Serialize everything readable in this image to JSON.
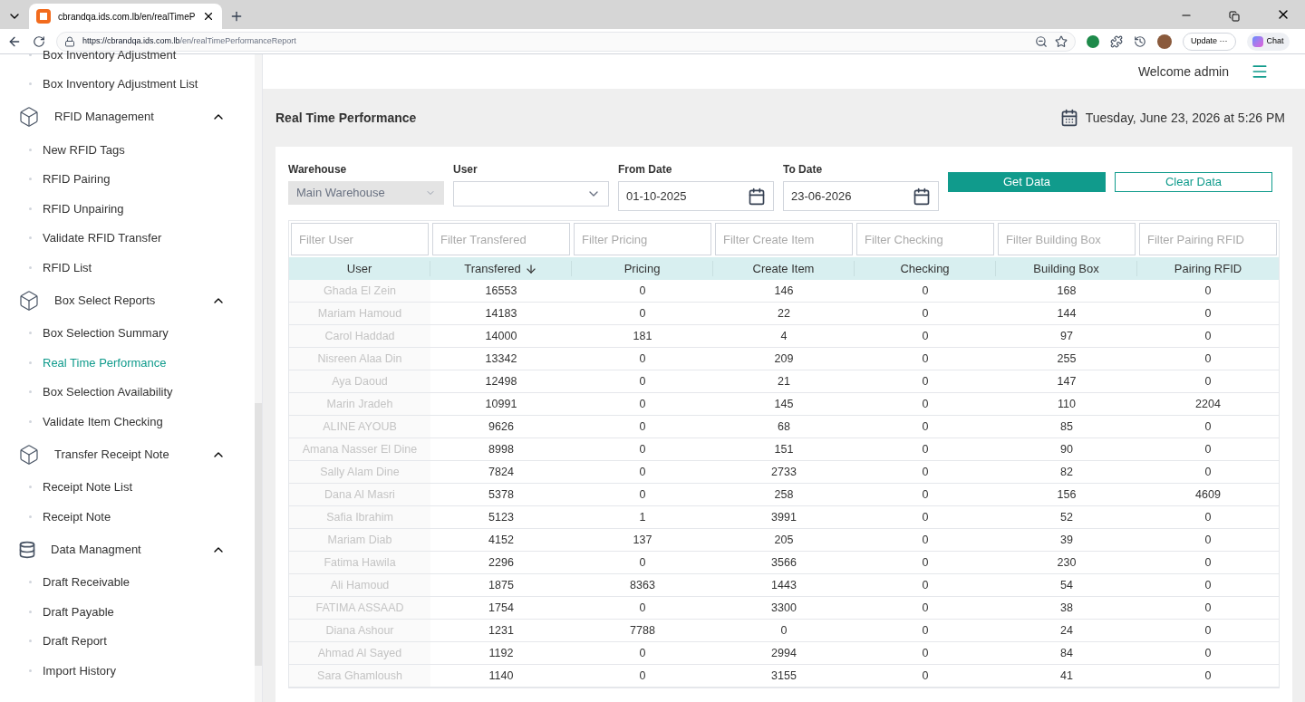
{
  "browser": {
    "tab_title": "cbrandqa.ids.com.lb/en/realTimeP",
    "url_host": "https://cbrandqa.ids.com.lb",
    "url_path": "/en/realTimePerformanceReport",
    "update_label": "Update",
    "update_more": "···",
    "chat_label": "Chat"
  },
  "sidebar": {
    "items": [
      {
        "kind": "link",
        "label": "Box Inventory Adjustment",
        "selected": false
      },
      {
        "kind": "link",
        "label": "Box Inventory Adjustment List",
        "selected": false
      },
      {
        "kind": "group",
        "label": "RFID Management",
        "expanded": true,
        "children": [
          {
            "label": "New RFID Tags",
            "selected": false
          },
          {
            "label": "RFID Pairing",
            "selected": false
          },
          {
            "label": "RFID Unpairing",
            "selected": false
          },
          {
            "label": "Validate RFID Transfer",
            "selected": false
          },
          {
            "label": "RFID List",
            "selected": false
          }
        ]
      },
      {
        "kind": "group",
        "label": "Box Select Reports",
        "expanded": true,
        "children": [
          {
            "label": "Box Selection Summary",
            "selected": false
          },
          {
            "label": "Real Time Performance",
            "selected": true
          },
          {
            "label": "Box Selection Availability",
            "selected": false
          },
          {
            "label": "Validate Item Checking",
            "selected": false
          }
        ]
      },
      {
        "kind": "group",
        "label": "Transfer Receipt Note",
        "expanded": true,
        "children": [
          {
            "label": "Receipt Note List",
            "selected": false
          },
          {
            "label": "Receipt Note",
            "selected": false
          }
        ]
      },
      {
        "kind": "group",
        "label": "Data Managment",
        "expanded": true,
        "children": [
          {
            "label": "Draft Receivable",
            "selected": false
          },
          {
            "label": "Draft Payable",
            "selected": false
          },
          {
            "label": "Draft Report",
            "selected": false
          },
          {
            "label": "Import History",
            "selected": false
          }
        ]
      }
    ]
  },
  "header": {
    "welcome": "Welcome admin"
  },
  "page": {
    "title": "Real Time Performance",
    "datetime": "Tuesday, June 23, 2026 at 5:26 PM"
  },
  "filters": {
    "warehouse": {
      "label": "Warehouse",
      "value": "Main Warehouse",
      "disabled": true
    },
    "user": {
      "label": "User",
      "disabled": false
    },
    "from_date": {
      "label": "From Date",
      "value": "01-10-2025"
    },
    "to_date": {
      "label": "To Date",
      "value": "23-06-2026"
    },
    "get_button": "Get Data",
    "clear_button": "Clear Data"
  },
  "table": {
    "columns": [
      {
        "title": "User",
        "filter_placeholder": "Filter User",
        "sorted_descending": false
      },
      {
        "title": "Transfered",
        "filter_placeholder": "Filter Transfered",
        "sorted_descending": true
      },
      {
        "title": "Pricing",
        "filter_placeholder": "Filter Pricing",
        "sorted_descending": false
      },
      {
        "title": "Create Item",
        "filter_placeholder": "Filter Create Item",
        "sorted_descending": false
      },
      {
        "title": "Checking",
        "filter_placeholder": "Filter Checking",
        "sorted_descending": false
      },
      {
        "title": "Building Box",
        "filter_placeholder": "Filter Building Box",
        "sorted_descending": false
      },
      {
        "title": "Pairing RFID",
        "filter_placeholder": "Filter Pairing RFID",
        "sorted_descending": false
      }
    ],
    "rows": [
      [
        "Ghada El Zein",
        "16553",
        "0",
        "146",
        "0",
        "168",
        "0"
      ],
      [
        "Mariam Hamoud",
        "14183",
        "0",
        "22",
        "0",
        "144",
        "0"
      ],
      [
        "Carol Haddad",
        "14000",
        "181",
        "4",
        "0",
        "97",
        "0"
      ],
      [
        "Nisreen Alaa Din",
        "13342",
        "0",
        "209",
        "0",
        "255",
        "0"
      ],
      [
        "Aya Daoud",
        "12498",
        "0",
        "21",
        "0",
        "147",
        "0"
      ],
      [
        "Marin Jradeh",
        "10991",
        "0",
        "145",
        "0",
        "110",
        "2204"
      ],
      [
        "ALINE AYOUB",
        "9626",
        "0",
        "68",
        "0",
        "85",
        "0"
      ],
      [
        "Amana Nasser El Dine",
        "8998",
        "0",
        "151",
        "0",
        "90",
        "0"
      ],
      [
        "Sally Alam Dine",
        "7824",
        "0",
        "2733",
        "0",
        "82",
        "0"
      ],
      [
        "Dana Al Masri",
        "5378",
        "0",
        "258",
        "0",
        "156",
        "4609"
      ],
      [
        "Safia Ibrahim",
        "5123",
        "1",
        "3991",
        "0",
        "52",
        "0"
      ],
      [
        "Mariam Diab",
        "4152",
        "137",
        "205",
        "0",
        "39",
        "0"
      ],
      [
        "Fatima Hawila",
        "2296",
        "0",
        "3566",
        "0",
        "230",
        "0"
      ],
      [
        "Ali Hamoud",
        "1875",
        "8363",
        "1443",
        "0",
        "54",
        "0"
      ],
      [
        "FATIMA ASSAAD",
        "1754",
        "0",
        "3300",
        "0",
        "38",
        "0"
      ],
      [
        "Diana Ashour",
        "1231",
        "7788",
        "0",
        "0",
        "24",
        "0"
      ],
      [
        "Ahmad Al Sayed",
        "1192",
        "0",
        "2994",
        "0",
        "84",
        "0"
      ],
      [
        "Sara Ghamloush",
        "1140",
        "0",
        "3155",
        "0",
        "41",
        "0"
      ]
    ]
  }
}
